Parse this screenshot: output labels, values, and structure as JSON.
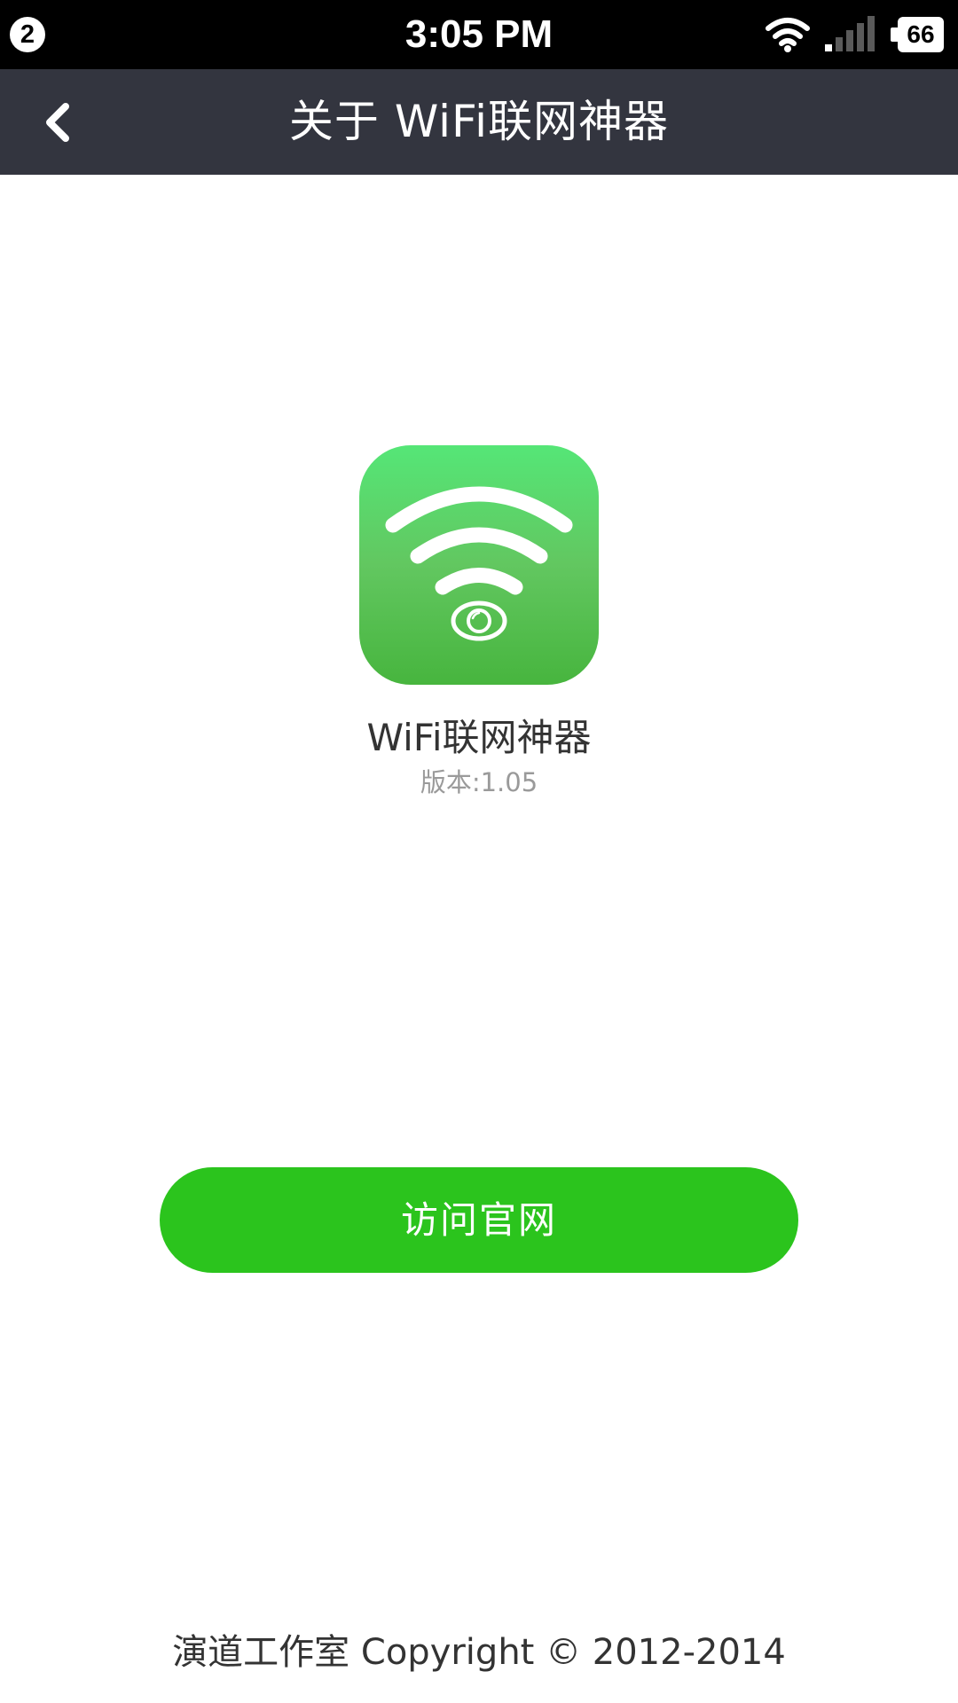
{
  "status_bar": {
    "notification_count": "2",
    "time": "3:05 PM",
    "wifi_icon": "wifi-icon",
    "signal_icon": "cellular-signal-icon",
    "battery_level": "66"
  },
  "nav": {
    "back_icon": "chevron-left-icon",
    "title": "关于 WiFi联网神器",
    "background_color": "#33353f"
  },
  "app": {
    "icon": "wifi-eye-app-icon",
    "name": "WiFi联网神器",
    "version": "版本:1.05"
  },
  "actions": {
    "visit_website_label": "访问官网",
    "button_color": "#2bc41d"
  },
  "footer": {
    "copyright": "演道工作室 Copyright © 2012-2014"
  }
}
